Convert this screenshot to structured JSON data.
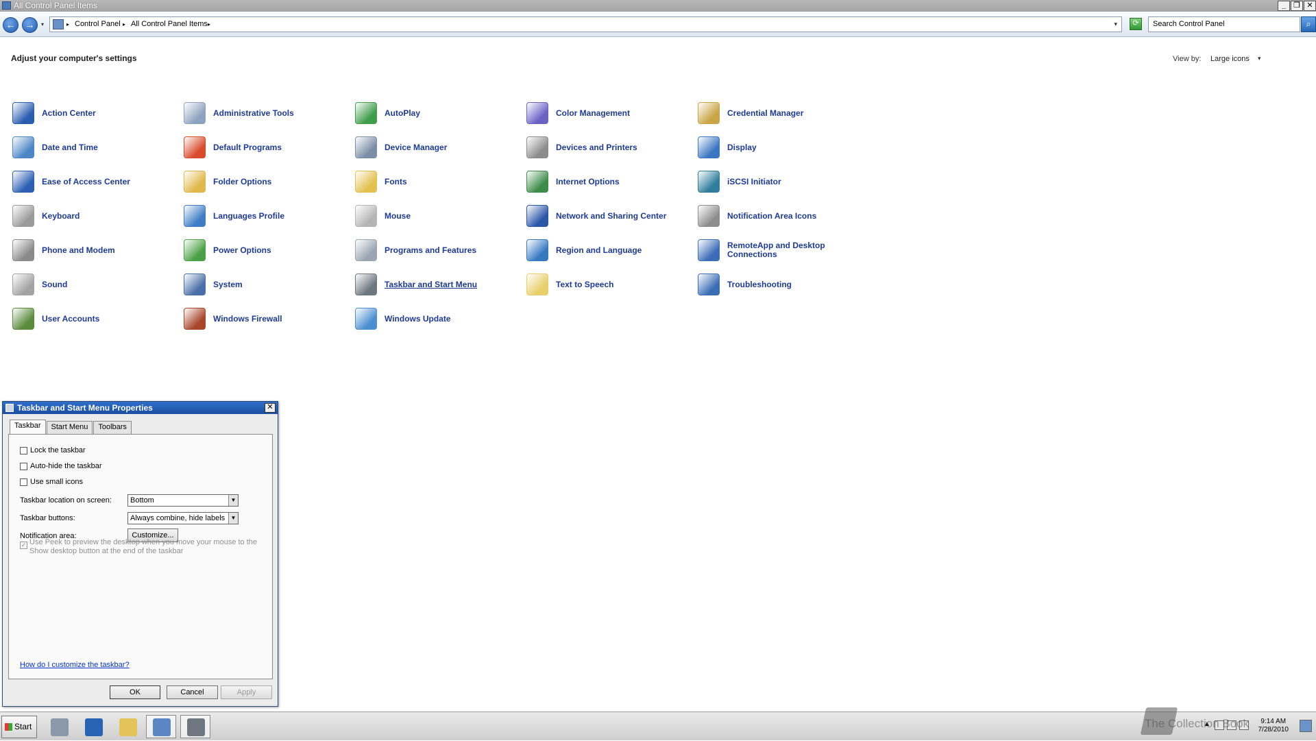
{
  "window": {
    "title": "All Control Panel Items",
    "controls": {
      "minimize": "_",
      "restore": "❐",
      "close": "✕"
    }
  },
  "nav": {
    "back": "←",
    "forward": "→",
    "drop": "▾"
  },
  "address": {
    "crumbs": [
      "Control Panel",
      "All Control Panel Items"
    ],
    "crumb_arrow": "▸",
    "dropdown": "▾"
  },
  "search": {
    "placeholder": "Search Control Panel",
    "button": "⌕"
  },
  "main": {
    "heading": "Adjust your computer's settings",
    "view_by_label": "View by:",
    "view_by_value": "Large icons",
    "view_by_arrow": "▾"
  },
  "items": [
    {
      "label": "Action Center",
      "icon": "flag-icon",
      "color": "#2a5db0"
    },
    {
      "label": "Administrative Tools",
      "icon": "admin-tools-icon",
      "color": "#8da3bf"
    },
    {
      "label": "AutoPlay",
      "icon": "autoplay-icon",
      "color": "#3f9d4b"
    },
    {
      "label": "Color Management",
      "icon": "color-management-icon",
      "color": "#6b62c4"
    },
    {
      "label": "Credential Manager",
      "icon": "credential-vault-icon",
      "color": "#c9a545"
    },
    {
      "label": "Date and Time",
      "icon": "calendar-clock-icon",
      "color": "#4c86c6"
    },
    {
      "label": "Default Programs",
      "icon": "default-programs-icon",
      "color": "#d94a2a"
    },
    {
      "label": "Device Manager",
      "icon": "device-manager-icon",
      "color": "#7b8ea6"
    },
    {
      "label": "Devices and Printers",
      "icon": "printer-icon",
      "color": "#8c8c8c"
    },
    {
      "label": "Display",
      "icon": "monitor-icon",
      "color": "#3b76c2"
    },
    {
      "label": "Ease of Access Center",
      "icon": "ease-of-access-icon",
      "color": "#2c5fb3"
    },
    {
      "label": "Folder Options",
      "icon": "folder-options-icon",
      "color": "#e0b84a"
    },
    {
      "label": "Fonts",
      "icon": "fonts-folder-icon",
      "color": "#e3c04f"
    },
    {
      "label": "Internet Options",
      "icon": "globe-icon",
      "color": "#3d8c4a"
    },
    {
      "label": "iSCSI Initiator",
      "icon": "iscsi-globe-icon",
      "color": "#2f7d9b"
    },
    {
      "label": "Keyboard",
      "icon": "keyboard-icon",
      "color": "#9a9a9a"
    },
    {
      "label": "Languages Profile",
      "icon": "languages-globe-icon",
      "color": "#3e7dc4"
    },
    {
      "label": "Mouse",
      "icon": "mouse-icon",
      "color": "#b5b5b5"
    },
    {
      "label": "Network and Sharing Center",
      "icon": "network-icon",
      "color": "#2a56a8"
    },
    {
      "label": "Notification Area Icons",
      "icon": "notification-area-icon",
      "color": "#8d8d8d"
    },
    {
      "label": "Phone and Modem",
      "icon": "phone-icon",
      "color": "#8a8a8a"
    },
    {
      "label": "Power Options",
      "icon": "power-options-icon",
      "color": "#4aa044"
    },
    {
      "label": "Programs and Features",
      "icon": "programs-features-icon",
      "color": "#9aa5b1"
    },
    {
      "label": "Region and Language",
      "icon": "region-globe-icon",
      "color": "#3478c0"
    },
    {
      "label": "RemoteApp and Desktop Connections",
      "icon": "remoteapp-icon",
      "color": "#3c6cb7"
    },
    {
      "label": "Sound",
      "icon": "speaker-icon",
      "color": "#a3a3a3"
    },
    {
      "label": "System",
      "icon": "system-icon",
      "color": "#4a6fa8"
    },
    {
      "label": "Taskbar and Start Menu",
      "icon": "taskbar-icon",
      "color": "#6e7680",
      "underline": true
    },
    {
      "label": "Text to Speech",
      "icon": "speech-bubble-icon",
      "color": "#e8cf6a"
    },
    {
      "label": "Troubleshooting",
      "icon": "troubleshooting-icon",
      "color": "#3b6db5"
    },
    {
      "label": "User Accounts",
      "icon": "users-icon",
      "color": "#5a8a3c"
    },
    {
      "label": "Windows Firewall",
      "icon": "firewall-icon",
      "color": "#a8462a"
    },
    {
      "label": "Windows Update",
      "icon": "windows-update-icon",
      "color": "#4b8fd1"
    }
  ],
  "dialog": {
    "title": "Taskbar and Start Menu Properties",
    "close": "✕",
    "tabs": [
      "Taskbar",
      "Start Menu",
      "Toolbars"
    ],
    "checkboxes": {
      "lock": "Lock the taskbar",
      "autohide": "Auto-hide the taskbar",
      "small_icons": "Use small icons"
    },
    "location_label": "Taskbar location on screen:",
    "location_value": "Bottom",
    "buttons_label": "Taskbar buttons:",
    "buttons_value": "Always combine, hide labels",
    "notification_label": "Notification area:",
    "customize_button": "Customize...",
    "peek_text": "Use Peek to preview the desktop when you move your mouse to the Show desktop button at the end of the taskbar",
    "peek_check": "✓",
    "help_link": "How do I customize the taskbar?",
    "ok": "OK",
    "cancel": "Cancel",
    "apply": "Apply",
    "dd_arrow": "▼"
  },
  "taskbar": {
    "start": "Start",
    "time": "9:14 AM",
    "date": "7/28/2010",
    "watermark": "The Collection Book"
  }
}
